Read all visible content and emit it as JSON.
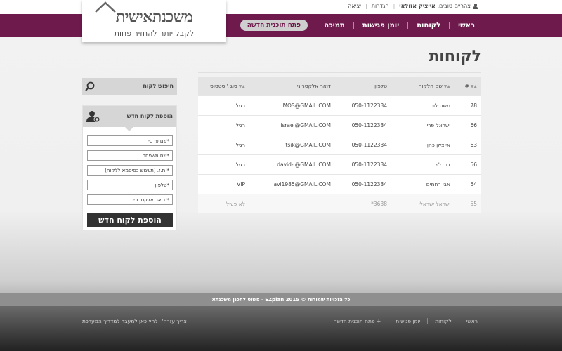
{
  "header": {
    "greeting": "צהריים טובים,",
    "user_name": "אייציק אזולאי",
    "settings_label": "הגדרות",
    "logout_label": "יציאה"
  },
  "logo": {
    "title": "משכנתאישית",
    "subtitle": "לקבל יותר להחזיר פחות"
  },
  "nav": {
    "items": [
      "ראשי",
      "לקוחות",
      "יומן פגישות",
      "תמיכה"
    ],
    "new_plan_label": "פתח תוכנית חדשה"
  },
  "page": {
    "title": "לקוחות"
  },
  "table": {
    "headers": [
      "#",
      "שם הלקוח",
      "טלפון",
      "דואר אלקטרוני",
      "סוג \\ סטטוס"
    ],
    "rows": [
      {
        "id": "78",
        "name": "משה לוי",
        "phone": "050-1122334",
        "email": "MOS@GMAIL.COM",
        "status": "רגיל"
      },
      {
        "id": "66",
        "name": "ישראל פרי",
        "phone": "050-1122334",
        "email": "israel@GMAIL.COM",
        "status": "רגיל"
      },
      {
        "id": "63",
        "name": "אייציק כהן",
        "phone": "050-1122334",
        "email": "itsik@GMAIL.COM",
        "status": "רגיל"
      },
      {
        "id": "56",
        "name": "דוד לוי",
        "phone": "050-1122334",
        "email": "david-l@GMAIL.COM",
        "status": "רגיל"
      },
      {
        "id": "54",
        "name": "אבי רחמים",
        "phone": "050-1122334",
        "email": "avi1985@GMAIL.COM",
        "status": "VIP"
      },
      {
        "id": "55",
        "name": "ישראל ישראלי",
        "phone": "3638*",
        "email": "",
        "status": "לא פעיל"
      }
    ]
  },
  "search": {
    "label": "חיפוש לקוח",
    "value": ""
  },
  "add_customer": {
    "title": "הוספת לקוח חדש",
    "first_name_placeholder": "*שם פרטי",
    "last_name_placeholder": "*שם משפחה",
    "id_placeholder": "* ת.ז. (תשמש כסיסמא ללקוח)",
    "phone_placeholder": "*טלפון",
    "email_placeholder": "* דואר אלקטרוני",
    "submit_label": "הוספת לקוח חדש"
  },
  "footer": {
    "copyright": "כל הזכויות שמורות © 2015 EZplan - פשוט לתכנן משכנתא",
    "nav_items": [
      "ראשי",
      "לקוחות",
      "יומן פגישות",
      "+ פתח תוכנית חדשה"
    ],
    "help_label": "צריך עזרה?",
    "help_link": "לחץ כאן למעבר למדריך המערכת"
  },
  "colors": {
    "brand_purple": "#6e1a4c",
    "button_dark": "#333333",
    "pill_bg": "#cfcfcf"
  }
}
